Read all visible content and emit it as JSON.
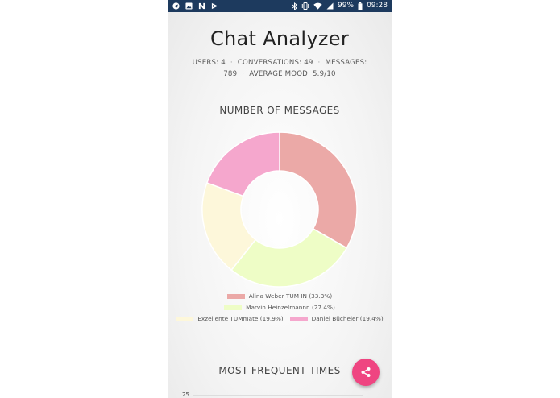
{
  "statusbar": {
    "battery": "99%",
    "time": "09:28",
    "icons": [
      "telegram-icon",
      "image-icon",
      "n-app-icon",
      "flag-icon",
      "bluetooth-icon",
      "vibrate-icon",
      "wifi-icon",
      "signal-icon",
      "battery-icon"
    ]
  },
  "app": {
    "title": "Chat Analyzer"
  },
  "stats": {
    "users": "USERS: 4",
    "conversations": "CONVERSATIONS: 49",
    "messages_label": "MESSAGES:",
    "messages_value": "789",
    "mood": "AVERAGE MOOD: 5.9/10"
  },
  "sections": {
    "messages": "NUMBER OF MESSAGES",
    "times": "MOST FREQUENT TIMES"
  },
  "chart_data": {
    "type": "pie",
    "donut": true,
    "categories": [
      "Alina Weber TUM IN",
      "Marvin Heinzelmannn",
      "Exzellente TUMmate",
      "Daniel Bücheler"
    ],
    "values": [
      33.3,
      27.4,
      19.9,
      19.4
    ],
    "legend_labels": [
      "Alina Weber TUM IN (33.3%)",
      "Marvin Heinzelmannn (27.4%)",
      "Exzellente TUMmate (19.9%)",
      "Daniel Bücheler (19.4%)"
    ],
    "colors": [
      "#eba9a7",
      "#eefdc6",
      "#fdf7da",
      "#f5a7cd"
    ],
    "legend_position": "bottom"
  },
  "times_chart": {
    "first_tick": "25"
  },
  "fab": {
    "icon": "share-icon"
  },
  "colors": {
    "statusbar": "#1d3a5e",
    "fab": "#ef4581"
  }
}
